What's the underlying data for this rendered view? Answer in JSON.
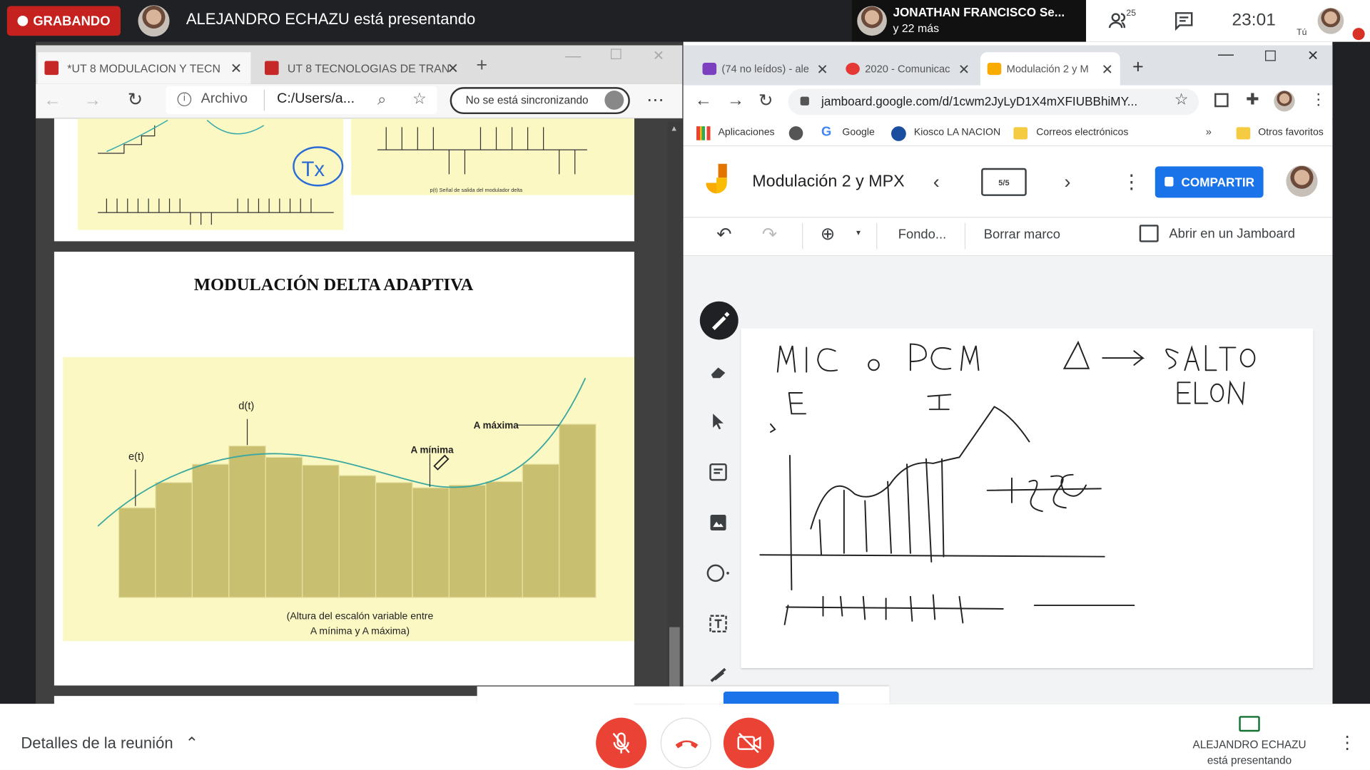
{
  "meet": {
    "recording_label": "GRABANDO",
    "presenter_banner": "ALEJANDRO ECHAZU está presentando",
    "participant_name": "JONATHAN FRANCISCO Se...",
    "participant_more": "y 22 más",
    "participant_count": "25",
    "clock": "23:01",
    "self_label": "Tú",
    "details_label": "Detalles de la reunión",
    "presenting_name": "ALEJANDRO ECHAZU",
    "presenting_sub": "está presentando"
  },
  "edge": {
    "tabs": [
      "*UT 8 MODULACION Y TECN",
      "UT 8 TECNOLOGIAS DE TRAN"
    ],
    "address_label": "Archivo",
    "address_path": "C:/Users/a...",
    "sync_label": "No se está sincronizando"
  },
  "pdf": {
    "title": "MODULACIÓN DELTA ADAPTIVA",
    "top_caption": "p(t) Señal de salida del modulador delta",
    "tx_note": "Tx",
    "labels": {
      "dt": "d(t)",
      "et": "e(t)",
      "amax": "A máxima",
      "amin": "A mínima"
    },
    "caption_line1": "(Altura del escalón variable entre",
    "caption_line2": "A mínima y A máxima)"
  },
  "chrome": {
    "tabs": [
      "(74 no leídos) - ale",
      "2020 - Comunicac",
      "Modulación 2 y M"
    ],
    "url": "jamboard.google.com/d/1cwm2JyLyD1X4mXFIUBBhiMY...",
    "bookmarks": [
      "Aplicaciones",
      "Google",
      "Kiosco LA NACION",
      "Correos electrónicos",
      "Otros favoritos"
    ]
  },
  "jamboard": {
    "title": "Modulación 2 y MPX",
    "frame_indicator": "5/5",
    "share_label": "COMPARTIR",
    "background_label": "Fondo...",
    "clear_label": "Borrar marco",
    "open_label": "Abrir en un Jamboard"
  },
  "colors": {
    "record": "#c5221f",
    "share": "#1a73e8",
    "chart_fill": "#c8c070",
    "chart_bg": "#fbf8c4",
    "end_call": "#ea4335"
  }
}
